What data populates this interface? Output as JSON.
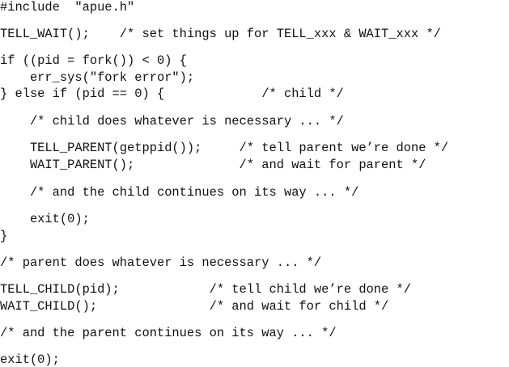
{
  "code_lines": [
    "#include  \"apue.h\"",
    "TELL_WAIT();    /* set things up for TELL_xxx & WAIT_xxx */",
    "if ((pid = fork()) < 0) {",
    "    err_sys(\"fork error\");",
    "} else if (pid == 0) {             /* child */",
    "    /* child does whatever is necessary ... */",
    "    TELL_PARENT(getppid());     /* tell parent we’re done */",
    "    WAIT_PARENT();              /* and wait for parent */",
    "    /* and the child continues on its way ... */",
    "    exit(0);",
    "}",
    "/* parent does whatever is necessary ... */",
    "TELL_CHILD(pid);            /* tell child we’re done */",
    "WAIT_CHILD();               /* and wait for child */",
    "/* and the parent continues on its way ... */",
    "exit(0);"
  ]
}
